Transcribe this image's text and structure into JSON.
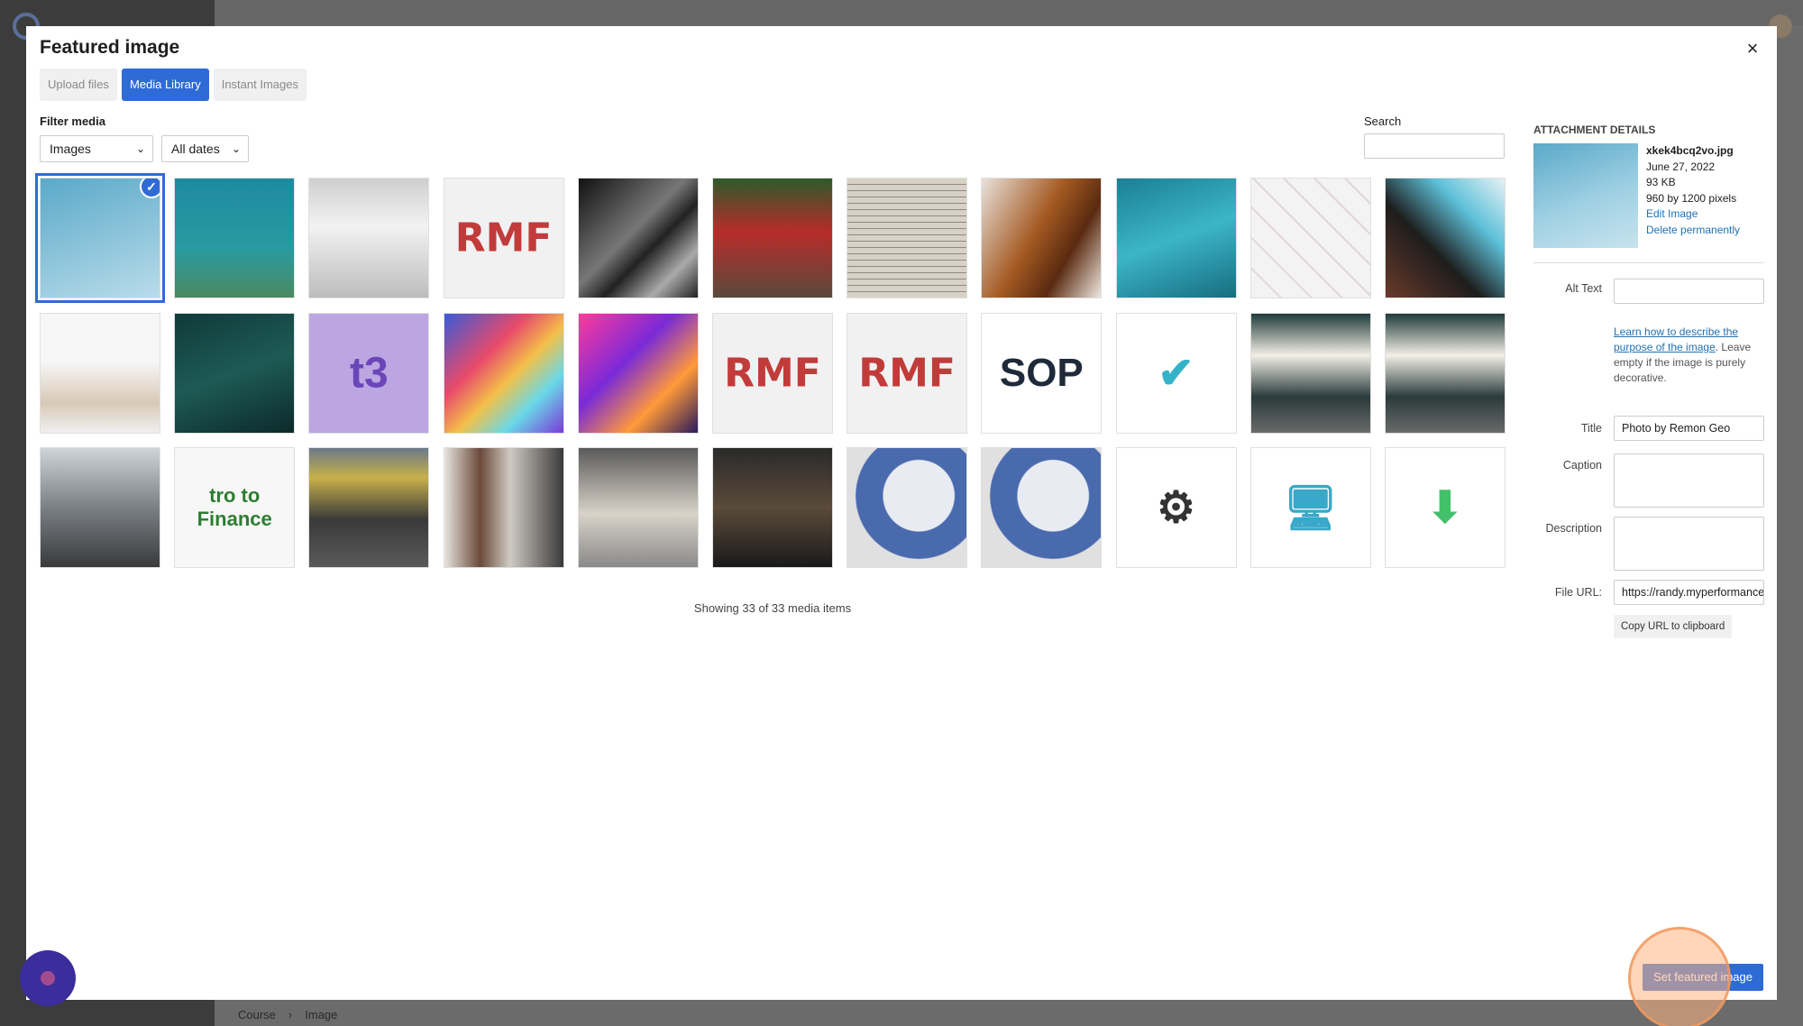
{
  "modal": {
    "title": "Featured image",
    "close_symbol": "×",
    "tabs": [
      {
        "label": "Upload files",
        "active": false
      },
      {
        "label": "Media Library",
        "active": true
      },
      {
        "label": "Instant Images",
        "active": false
      }
    ]
  },
  "filter": {
    "label": "Filter media",
    "type_value": "Images",
    "date_value": "All dates"
  },
  "search": {
    "label": "Search",
    "value": ""
  },
  "media_items": [
    {
      "name": "crane-sky",
      "bg": "linear-gradient(160deg,#5aa9c9,#b9dcea)",
      "selected": true
    },
    {
      "name": "sea-turtle-shallow",
      "bg": "linear-gradient(180deg,#1d8aa0,#2a9aa0 60%,#4a8a60)"
    },
    {
      "name": "museum-atrium",
      "bg": "linear-gradient(180deg,#cfcfcf,#f2f2f2 40%,#bdbdbd)"
    },
    {
      "name": "rmf-logo",
      "bg": "#f1f1f1",
      "glyph": "RMF",
      "glyph_color": "#c23b3b"
    },
    {
      "name": "window-light",
      "bg": "linear-gradient(135deg,#111 0%,#777 45%,#222 60%,#aaa 80%,#222)"
    },
    {
      "name": "fire-truck-crowd",
      "bg": "linear-gradient(180deg,#2e5a2a,#b72c2a 45%,#5a4a3a)"
    },
    {
      "name": "sheet-music",
      "bg": "repeating-linear-gradient(0deg,#d8d2c6 0 6px,#8f8a82 6px 7px)"
    },
    {
      "name": "violin",
      "bg": "linear-gradient(120deg,#e8e2dc,#a55a22 45%,#5a2a10 70%,#efe8e0)"
    },
    {
      "name": "blue-feathers",
      "bg": "linear-gradient(160deg,#1b7f94,#3cb5c8 50%,#176d80)"
    },
    {
      "name": "playing-cards",
      "bg": "repeating-linear-gradient(45deg,#f3f3f3 0 22px,#e2d6d6 22px 24px)"
    },
    {
      "name": "building-facade",
      "bg": "linear-gradient(45deg,#6b3a2a,#1d1d1d 40%,#5dc0d8 70%,#e6f2f5)"
    },
    {
      "name": "plant-vases",
      "bg": "linear-gradient(180deg,#f7f7f7 40%,#d8c9b6 75%,#f0f0f0)"
    },
    {
      "name": "sea-turtle-dark",
      "bg": "linear-gradient(160deg,#0f3a3a,#1e5a55 50%,#0b2a2a)"
    },
    {
      "name": "t3-coin",
      "bg": "#bca6e2",
      "glyph": "t3",
      "glyph_color": "#6a46b8"
    },
    {
      "name": "abstract-paint",
      "bg": "linear-gradient(135deg,#3a5ad8,#e84a6a 35%,#f3c04a 55%,#6ad8e8 75%,#7a3ad8)"
    },
    {
      "name": "laptop-neon",
      "bg": "linear-gradient(135deg,#ff3a9a,#7a2ad8 40%,#ff9a3a 70%,#2a1a5a)"
    },
    {
      "name": "rmf-logo-2",
      "bg": "#f1f1f1",
      "glyph": "RMF",
      "glyph_color": "#c23b3b"
    },
    {
      "name": "rmf-logo-3",
      "bg": "#f1f1f1",
      "glyph": "RMF",
      "glyph_color": "#c23b3b"
    },
    {
      "name": "sop-sign",
      "bg": "#ffffff",
      "glyph": "SOP",
      "glyph_color": "#1e2a3a"
    },
    {
      "name": "clipboard-shield",
      "bg": "#ffffff",
      "glyph": "✔",
      "glyph_color": "#34b3c8"
    },
    {
      "name": "you-got-this-1",
      "bg": "linear-gradient(180deg,#1f3b3b,#f2efe6 35%,#2a3b3b 70%,#6a6a6a)"
    },
    {
      "name": "you-got-this-2",
      "bg": "linear-gradient(180deg,#1f3b3b,#f2efe6 35%,#2a3b3b 70%,#6a6a6a)"
    },
    {
      "name": "meeting-tired",
      "bg": "linear-gradient(180deg,#cfd4d8,#7a8086 50%,#3a3a3a)"
    },
    {
      "name": "finance-slide",
      "bg": "#f7f7f7",
      "glyph": "tro to Finance",
      "glyph_color": "#2e7d32"
    },
    {
      "name": "party-balloons",
      "bg": "linear-gradient(180deg,#6a7a8a,#c8b04a 25%,#3a3a3a 60%,#5a5a5a)"
    },
    {
      "name": "office-woman",
      "bg": "linear-gradient(90deg,#e8e4df,#6a4a3a 30%,#cfcac3 55%,#3a3a3a)"
    },
    {
      "name": "man-phone",
      "bg": "linear-gradient(180deg,#5a5a5a,#d8d2c8 55%,#8a8a8a)"
    },
    {
      "name": "man-dark",
      "bg": "linear-gradient(180deg,#2a2a2a,#5a4a3a 50%,#1a1a1a)"
    },
    {
      "name": "blue-circle-1",
      "bg": "radial-gradient(circle at 60% 40%,#e8ecf2 0 35%,#4a6aae 36% 62%,#e0e0e0 63%)"
    },
    {
      "name": "blue-circle-2",
      "bg": "radial-gradient(circle at 60% 40%,#e8ecf2 0 35%,#4a6aae 36% 62%,#e0e0e0 63%)"
    },
    {
      "name": "gear-orbit",
      "bg": "#ffffff",
      "glyph": "⚙",
      "glyph_color": "#333333"
    },
    {
      "name": "monitor-brain",
      "bg": "#ffffff",
      "glyph": "🖥",
      "glyph_color": "#3aa8c8"
    },
    {
      "name": "download-window",
      "bg": "#ffffff",
      "glyph": "⬇",
      "glyph_color": "#43c06a"
    }
  ],
  "count_text": "Showing 33 of 33 media items",
  "details": {
    "heading": "ATTACHMENT DETAILS",
    "filename": "xkek4bcq2vo.jpg",
    "date": "June 27, 2022",
    "size": "93 KB",
    "dimensions": "960 by 1200 pixels",
    "edit_link": "Edit Image",
    "delete_link": "Delete permanently",
    "alt_label": "Alt Text",
    "alt_value": "",
    "help_link": "Learn how to describe the purpose of the image",
    "help_text": ". Leave empty if the image is purely decorative.",
    "title_label": "Title",
    "title_value": "Photo by Remon Geo",
    "caption_label": "Caption",
    "description_label": "Description",
    "url_label": "File URL:",
    "url_value": "https://randy.myperformance",
    "copy_label": "Copy URL to clipboard"
  },
  "footer": {
    "set_button": "Set featured image"
  },
  "background": {
    "breadcrumb_1": "Course",
    "breadcrumb_sep": "›",
    "breadcrumb_2": "Image"
  }
}
